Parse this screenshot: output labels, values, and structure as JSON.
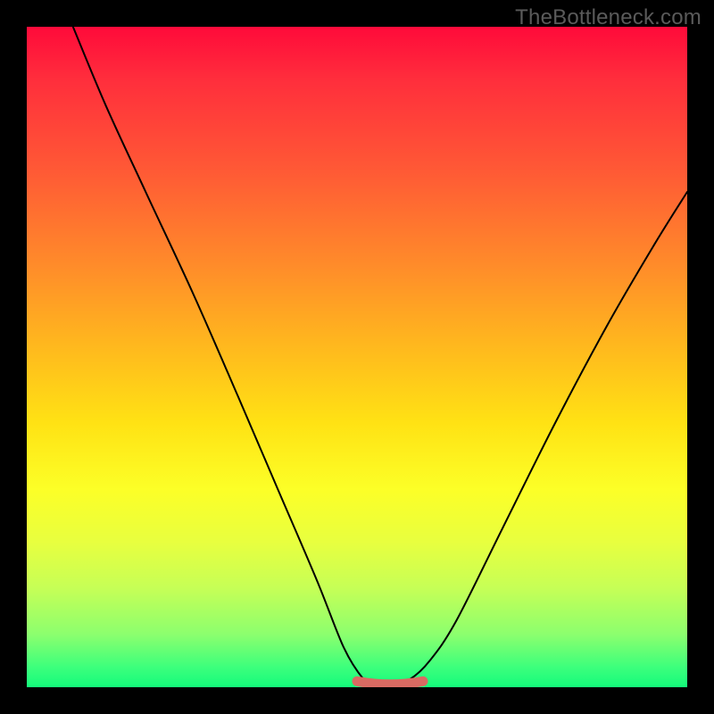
{
  "watermark": "TheBottleneck.com",
  "colors": {
    "background": "#000000",
    "curve": "#000000",
    "highlight": "#d96a62",
    "watermark_text": "#5a5a5a"
  },
  "chart_data": {
    "type": "line",
    "title": "",
    "xlabel": "",
    "ylabel": "",
    "xlim": [
      0,
      100
    ],
    "ylim": [
      0,
      100
    ],
    "grid": false,
    "legend": false,
    "series": [
      {
        "name": "bottleneck-curve",
        "x": [
          7,
          12,
          18,
          25,
          32,
          38,
          44,
          48,
          51,
          53,
          55,
          58,
          61,
          65,
          72,
          80,
          88,
          95,
          100
        ],
        "y": [
          100,
          88,
          75,
          60,
          44,
          30,
          16,
          6,
          1.2,
          0,
          0.3,
          1.2,
          4,
          10,
          24,
          40,
          55,
          67,
          75
        ]
      }
    ],
    "annotations": [
      {
        "name": "flat-bottom-highlight",
        "x_range": [
          50,
          60
        ],
        "y": 0.5,
        "color": "#d96a62"
      }
    ]
  }
}
